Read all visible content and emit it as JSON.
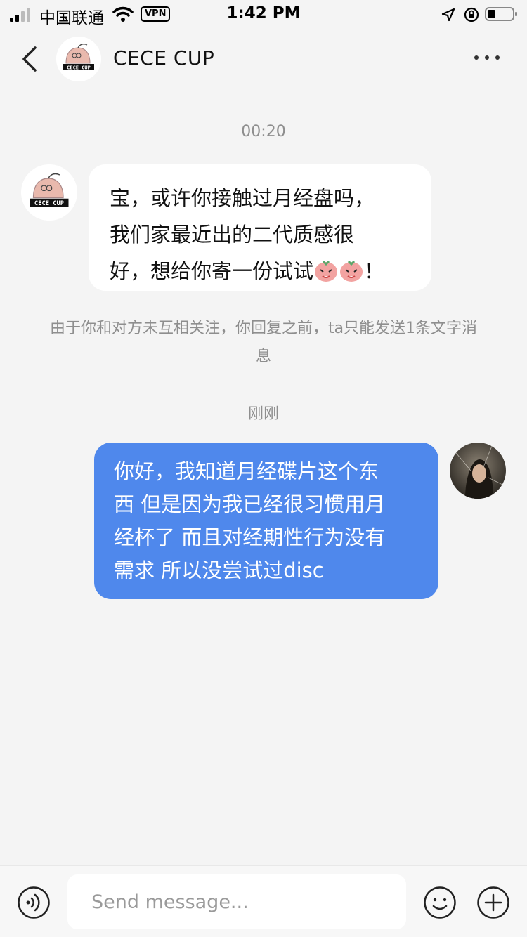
{
  "status_bar": {
    "carrier": "中国联通",
    "vpn": "VPN",
    "time": "1:42 PM"
  },
  "header": {
    "title": "CECE CUP",
    "back_icon": "chevron-left-icon",
    "more_icon": "more-horizontal-icon"
  },
  "brand_logo_text": "CECE CUP",
  "chat": {
    "timestamp_1": "00:20",
    "incoming": {
      "lines": [
        "宝，或许你接触过月经盘吗，",
        "我们家最近出的二代质感很",
        "好，想给你寄一份试试"
      ],
      "end": "！"
    },
    "notice": "由于你和对方未互相关注，你回复之前，ta只能发送1条文字消息",
    "timestamp_2": "刚刚",
    "outgoing": {
      "lines": [
        "你好，我知道月经碟片这个东",
        "西 但是因为我已经很习惯用月",
        "经杯了 而且对经期性行为没有",
        "需求 所以没尝试过disc"
      ]
    }
  },
  "composer": {
    "placeholder": "Send message...",
    "voice_icon": "voice-icon",
    "emoji_icon": "smiley-icon",
    "plus_icon": "plus-circle-icon"
  },
  "colors": {
    "background": "#f4f4f4",
    "outgoing_bubble": "#4f88ec",
    "incoming_bubble": "#ffffff",
    "meta_text": "#8e8e8e"
  }
}
